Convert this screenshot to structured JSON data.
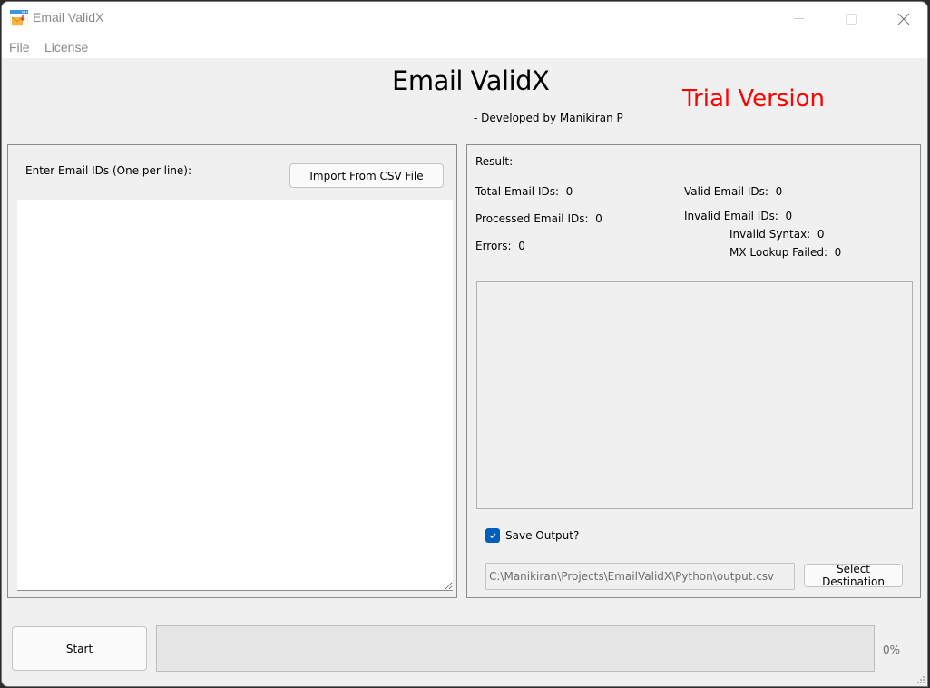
{
  "window": {
    "title": "Email ValidX",
    "icon": "email-app-icon",
    "controls": [
      "minimize",
      "maximize",
      "close"
    ]
  },
  "menu": {
    "items": [
      {
        "label": "File"
      },
      {
        "label": "License"
      }
    ]
  },
  "header": {
    "title": "Email ValidX",
    "subtitle": "- Developed by Manikiran P",
    "trial_label": "Trial Version",
    "trial_color": "#ff0000"
  },
  "input_panel": {
    "label": "Enter Email IDs (One per line):",
    "import_button": "Import From CSV File",
    "emails_value": ""
  },
  "result_panel": {
    "title": "Result:",
    "stats": {
      "total": {
        "label": "Total Email IDs:",
        "value": "0"
      },
      "processed": {
        "label": "Processed Email IDs:",
        "value": "0"
      },
      "errors": {
        "label": "Errors:",
        "value": "0"
      },
      "valid": {
        "label": "Valid Email IDs:",
        "value": "0"
      },
      "invalid": {
        "label": "Invalid Email IDs:",
        "value": "0"
      },
      "invalid_syntax": {
        "label": "Invalid Syntax:",
        "value": "0"
      },
      "mx_failed": {
        "label": "MX Lookup Failed:",
        "value": "0"
      }
    },
    "save_output": {
      "label": "Save Output?",
      "checked": true
    },
    "output_path": "C:\\Manikiran\\Projects\\EmailValidX\\Python\\output.csv",
    "select_destination_button": "Select Destination"
  },
  "footer": {
    "start_button": "Start",
    "progress_percent": 0,
    "progress_label": "0%"
  }
}
